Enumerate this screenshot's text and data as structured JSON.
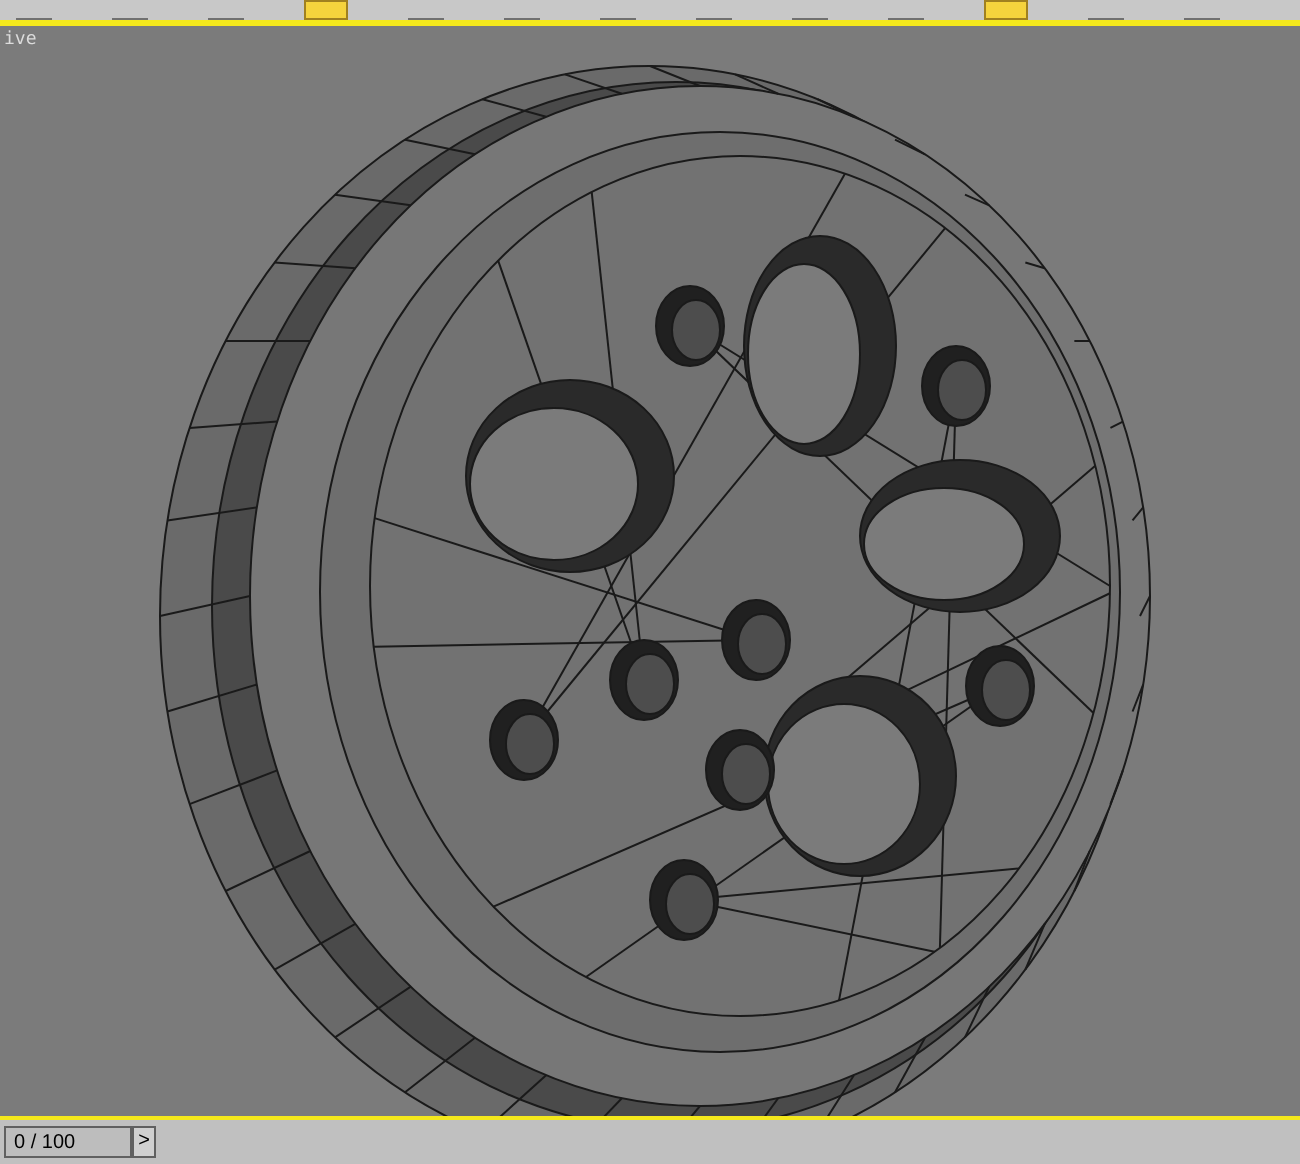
{
  "toolbar": [
    {
      "selected": false
    },
    {
      "selected": false
    },
    {
      "selected": false
    },
    {
      "selected": true
    },
    {
      "selected": false
    },
    {
      "selected": false
    },
    {
      "selected": false
    },
    {
      "selected": false
    },
    {
      "selected": false
    },
    {
      "selected": false
    },
    {
      "selected": true
    },
    {
      "selected": false
    },
    {
      "selected": false
    }
  ],
  "viewport": {
    "label": "ive"
  },
  "time_slider": {
    "frame": "0 / 100",
    "next": ">",
    "level": 0
  }
}
